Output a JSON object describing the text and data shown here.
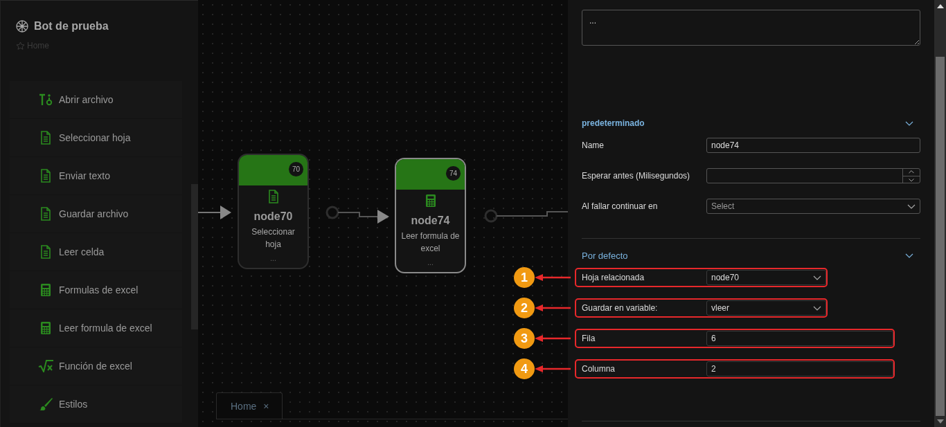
{
  "app": {
    "title": "Bot de prueba",
    "breadcrumb": "Home"
  },
  "sidebar": {
    "items": [
      {
        "label": "Abrir archivo",
        "kind": "open"
      },
      {
        "label": "Seleccionar hoja",
        "kind": "document"
      },
      {
        "label": "Enviar texto",
        "kind": "document"
      },
      {
        "label": "Guardar archivo",
        "kind": "document"
      },
      {
        "label": "Leer celda",
        "kind": "document"
      },
      {
        "label": "Formulas de excel",
        "kind": "calculator"
      },
      {
        "label": "Leer formula de excel",
        "kind": "calculator"
      },
      {
        "label": "Función de excel",
        "kind": "function"
      },
      {
        "label": "Estilos",
        "kind": "brush"
      }
    ]
  },
  "canvas": {
    "nodes": [
      {
        "name": "node70",
        "badge": "70",
        "subtitle": "Seleccionar hoja",
        "more": "...",
        "kind": "document",
        "selected": false
      },
      {
        "name": "node74",
        "badge": "74",
        "subtitle": "Leer formula de excel",
        "more": "...",
        "kind": "calculator",
        "selected": true
      }
    ],
    "tabs": [
      {
        "label": "Home",
        "close": "×",
        "selected": true
      }
    ]
  },
  "panel": {
    "description": "...",
    "sections": [
      {
        "title": "predeterminado",
        "expanded": true,
        "fields": [
          {
            "label": "Name",
            "kind": "text",
            "value": "node74",
            "highlighted": false
          },
          {
            "label": "Esperar antes (Milisegundos)",
            "kind": "number",
            "highlighted": false
          },
          {
            "label": "Al fallar continuar en",
            "kind": "select",
            "placeholder": "Select",
            "highlighted": false
          }
        ]
      },
      {
        "title": "Por defecto",
        "expanded": true,
        "fields": [
          {
            "label": "Hoja relacionada",
            "kind": "select",
            "value": "node70",
            "highlighted": true,
            "callout": "1"
          },
          {
            "label": "Guardar en variable:",
            "kind": "select",
            "value": "vleer",
            "highlighted": true,
            "callout": "2"
          },
          {
            "label": "Fila",
            "kind": "text",
            "value": "6",
            "highlighted": true,
            "callout": "3"
          },
          {
            "label": "Columna",
            "kind": "text",
            "value": "2",
            "highlighted": true,
            "callout": "4"
          }
        ]
      }
    ]
  }
}
